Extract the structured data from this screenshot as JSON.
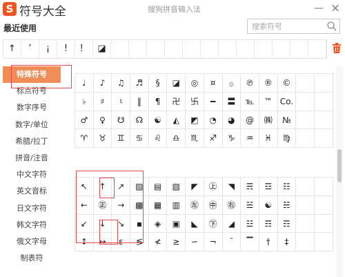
{
  "header": {
    "logo_text": "S",
    "title": "符号大全",
    "caption": "搜狗拼音输入法",
    "minimize": "—",
    "close": "×"
  },
  "recent": {
    "label": "最近使用",
    "items": [
      "↑",
      "’",
      "¡",
      "!",
      "！",
      "◪",
      "",
      "",
      "",
      "",
      "",
      "",
      "",
      "",
      "",
      "",
      "",
      ""
    ]
  },
  "search": {
    "placeholder": "搜索符号"
  },
  "sidebar": {
    "items": [
      {
        "label": "特殊符号",
        "active": true
      },
      {
        "label": "标点符号"
      },
      {
        "label": "数字序号"
      },
      {
        "label": "数字/单位"
      },
      {
        "label": "希腊/拉丁"
      },
      {
        "label": "拼音/注音"
      },
      {
        "label": "中文字符"
      },
      {
        "label": "英文音标"
      },
      {
        "label": "日文字符"
      },
      {
        "label": "韩文字符"
      },
      {
        "label": "俄文字母"
      },
      {
        "label": "制表符"
      }
    ]
  },
  "grid_top": [
    [
      "♩",
      "♪",
      "♫",
      "♬",
      "§",
      "◪",
      "◎",
      "¤",
      "۞",
      "℗",
      "®",
      "©",
      "",
      ""
    ],
    [
      "♭",
      "♯",
      "♮",
      "‖",
      "¶",
      "卍",
      "卐",
      "━",
      "〓",
      "℡",
      "™",
      "Co.",
      "",
      ""
    ],
    [
      "♂",
      "♀",
      "☋",
      "☊",
      "☯",
      "◭",
      "◩",
      "◔",
      "◕",
      "@",
      "㈱",
      "№",
      "",
      ""
    ],
    [
      "♈",
      "♉",
      "♊",
      "♋",
      "♌",
      "♎",
      "♏",
      "♐",
      "♑",
      "♒",
      "♓",
      "♍",
      "",
      ""
    ]
  ],
  "grid_bottom": [
    [
      "↖",
      "↑",
      "↗",
      "▨",
      "▤",
      "▧",
      "◤",
      "㊤",
      "◥",
      "☴",
      "☲",
      "☷",
      "",
      ""
    ],
    [
      "←",
      "㊣",
      "→",
      "▩",
      "▦",
      "▥",
      "㊧",
      "㊥",
      "㊨",
      "☱",
      "☯",
      "☵",
      "",
      ""
    ],
    [
      "↙",
      "↓",
      "↘",
      "▪",
      "◈",
      "▣",
      "◣",
      "㊦",
      "◢",
      "☳",
      "☶",
      "☶",
      "",
      ""
    ],
    [
      "↕",
      "↔",
      "ε",
      "≶",
      "≮",
      "≥",
      "∽",
      "¬",
      "¯",
      "▔",
      "†",
      "‡",
      "",
      ""
    ]
  ]
}
